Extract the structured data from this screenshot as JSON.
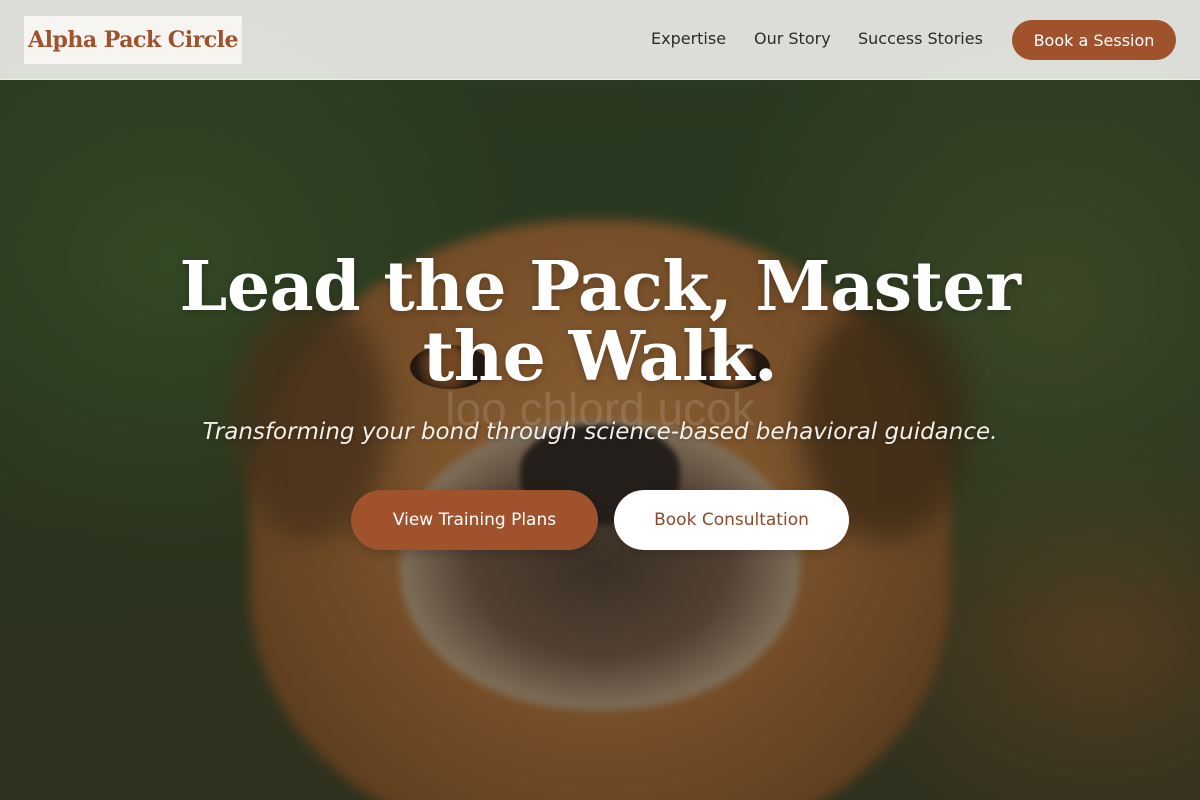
{
  "header": {
    "logo_text": "Alpha Pack Circle",
    "nav": {
      "expertise": "Expertise",
      "our_story": "Our Story",
      "success_stories": "Success Stories"
    },
    "cta_label": "Book a Session"
  },
  "hero": {
    "title": "Lead the Pack, Master the Walk.",
    "subtitle": "Transforming your bond through science-based behavioral guidance.",
    "primary_button": "View Training Plans",
    "secondary_button": "Book Consultation",
    "watermark_text": "loo chlord ucok"
  },
  "colors": {
    "accent": "#a0522d",
    "header_bg": "#ebebe8",
    "text_dark": "#2b2b2b",
    "white": "#ffffff"
  },
  "icons": [
    "hero-dog-photo"
  ]
}
